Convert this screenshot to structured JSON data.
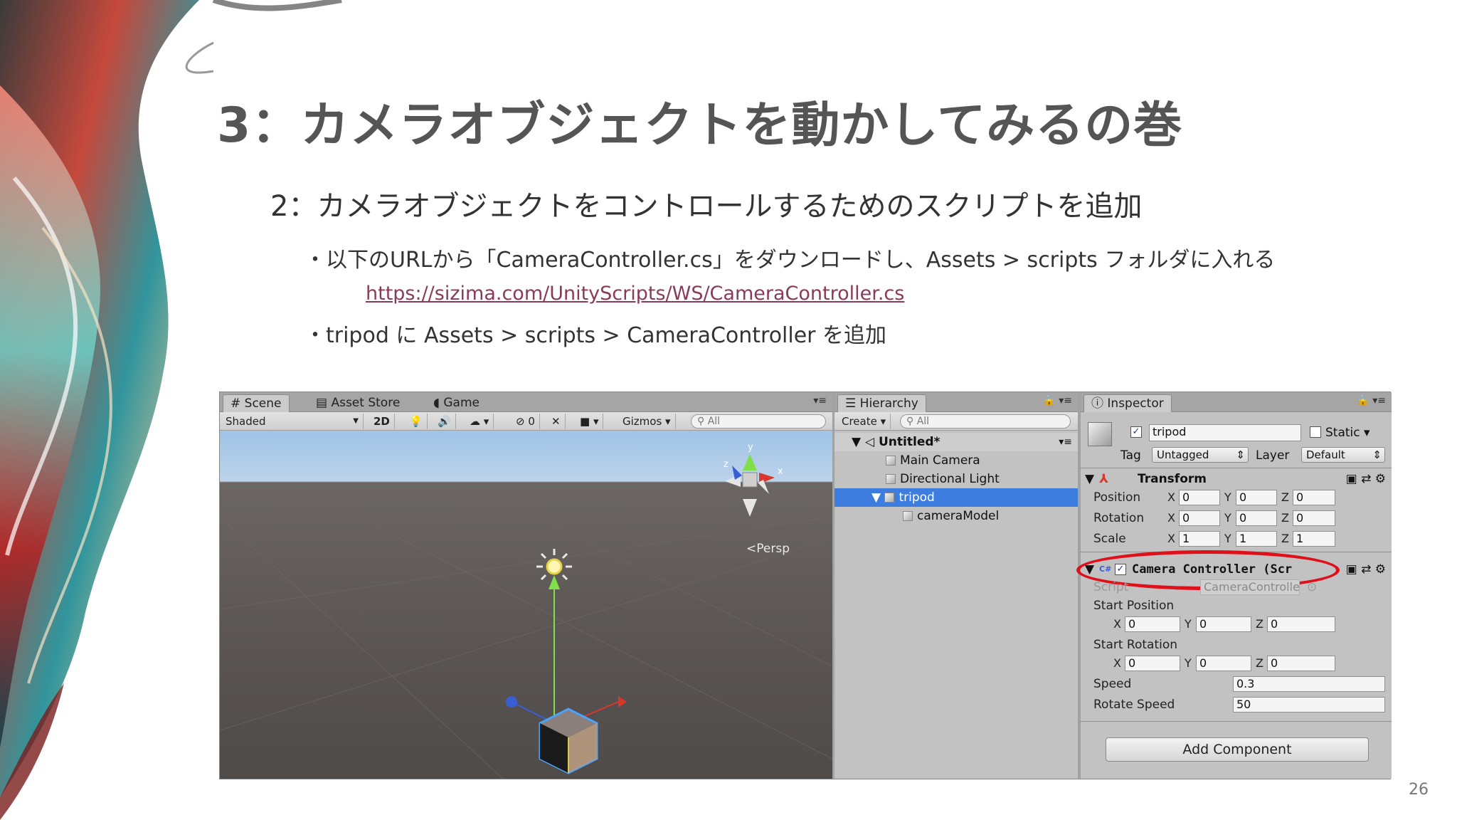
{
  "slide": {
    "title": "3：カメラオブジェクトを動かしてみるの巻",
    "subtitle": "2：カメラオブジェクトをコントロールするためのスクリプトを追加",
    "bullet1": "・以下のURLから「CameraController.cs」をダウンロードし、Assets > scripts フォルダに入れる",
    "link": "https://sizima.com/UnityScripts/WS/CameraController.cs",
    "bullet2": "・tripod に Assets > scripts > CameraController を追加",
    "page_number": "26"
  },
  "scene": {
    "tabs": [
      "Scene",
      "Asset Store",
      "Game"
    ],
    "toolbar": {
      "shading": "Shaded",
      "mode_2d": "2D",
      "effects_count": "0",
      "gizmos": "Gizmos",
      "search_placeholder": "All"
    },
    "persp_label": "Persp",
    "axis_y": "y",
    "axis_x": "x",
    "axis_z": "z"
  },
  "hierarchy": {
    "tab": "Hierarchy",
    "create": "Create",
    "search_placeholder": "All",
    "scene_name": "Untitled*",
    "items": [
      "Main Camera",
      "Directional Light",
      "tripod",
      "cameraModel"
    ]
  },
  "inspector": {
    "tab": "Inspector",
    "object_name": "tripod",
    "static_label": "Static",
    "tag_label": "Tag",
    "tag_value": "Untagged",
    "layer_label": "Layer",
    "layer_value": "Default",
    "transform": {
      "title": "Transform",
      "position_label": "Position",
      "rotation_label": "Rotation",
      "scale_label": "Scale",
      "position": [
        "0",
        "0",
        "0"
      ],
      "rotation": [
        "0",
        "0",
        "0"
      ],
      "scale": [
        "1",
        "1",
        "1"
      ]
    },
    "camera_controller": {
      "title": "Camera Controller (Scr",
      "script_label": "Script",
      "script_value": "CameraControlle",
      "start_position_label": "Start Position",
      "start_position": [
        "0",
        "0",
        "0"
      ],
      "start_rotation_label": "Start Rotation",
      "start_rotation": [
        "0",
        "0",
        "0"
      ],
      "speed_label": "Speed",
      "speed_value": "0.3",
      "rotate_speed_label": "Rotate Speed",
      "rotate_speed_value": "50"
    },
    "add_component": "Add Component",
    "axes": [
      "X",
      "Y",
      "Z"
    ]
  },
  "colors": {
    "highlight_ellipse": "#e0101a",
    "selection": "#3e7de0",
    "link": "#8a3b5a",
    "title": "#555555"
  }
}
